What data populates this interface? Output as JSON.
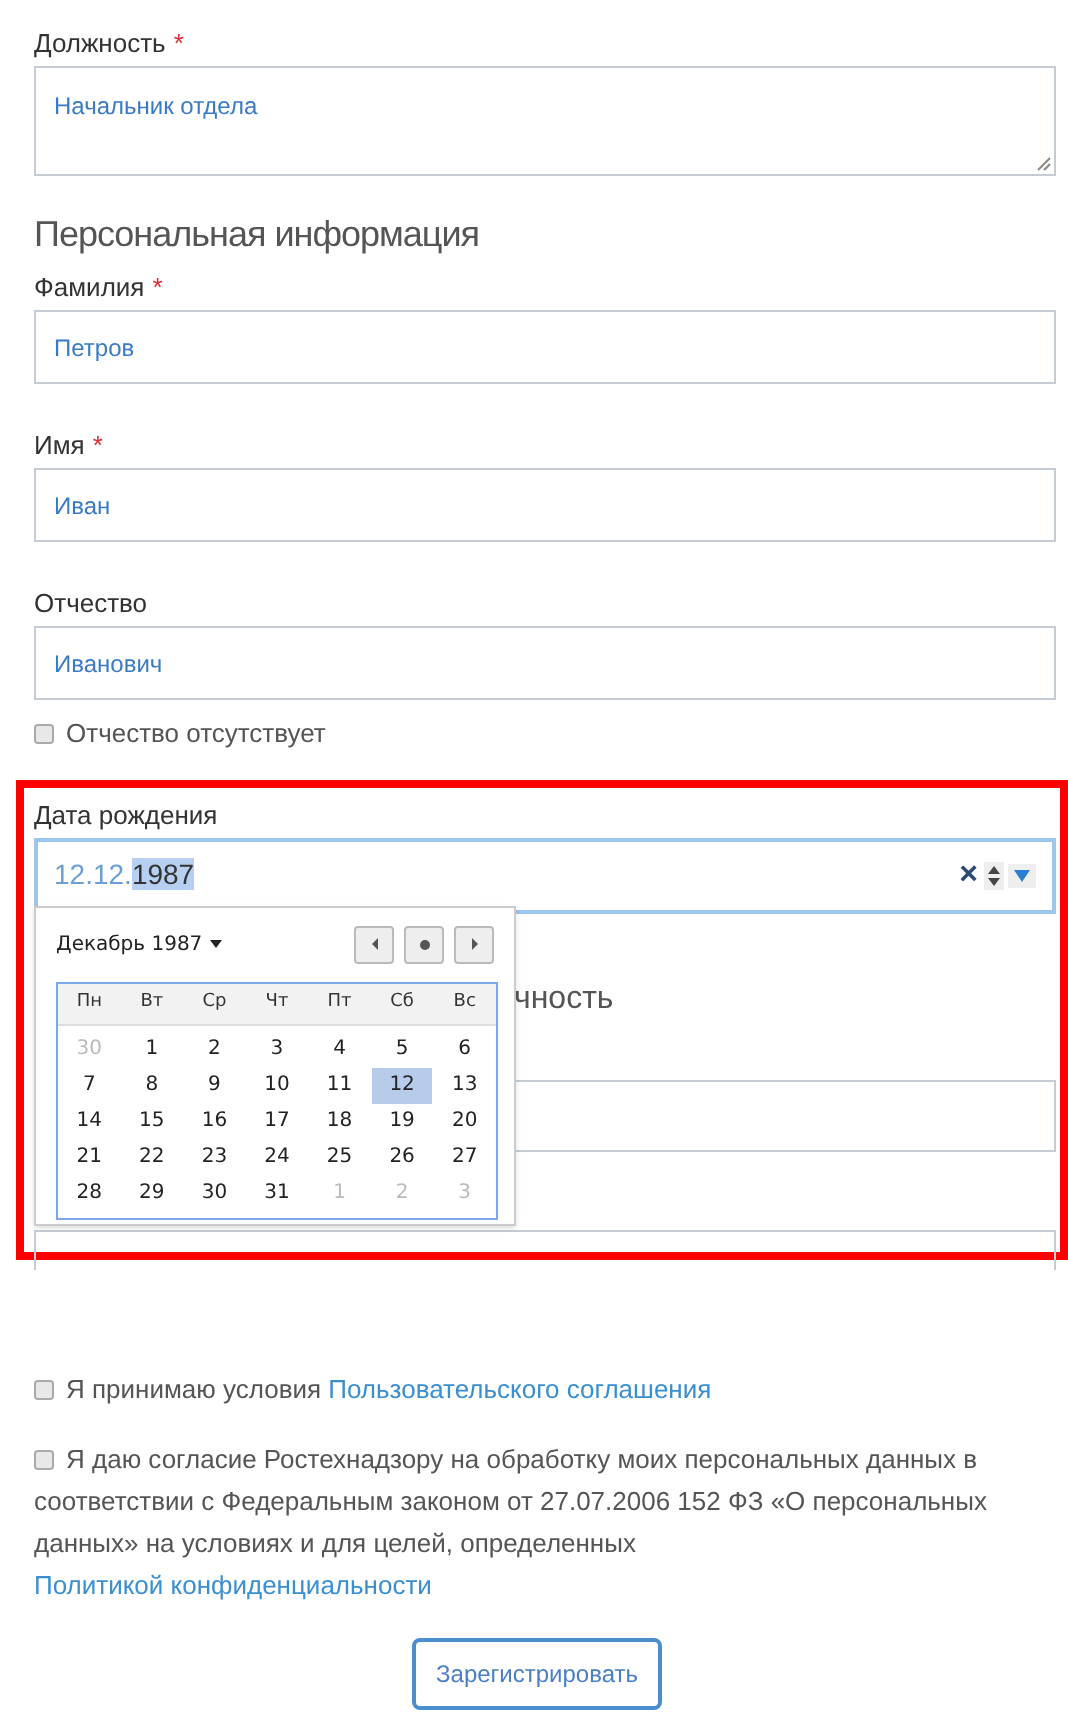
{
  "position_field": {
    "label": "Должность",
    "required_mark": "*",
    "value": "Начальник отдела"
  },
  "section_heading": "Персональная информация",
  "fields": [
    {
      "label": "Фамилия",
      "required_mark": "*",
      "value": "Петров"
    },
    {
      "label": "Имя",
      "required_mark": "*",
      "value": "Иван"
    },
    {
      "label": "Отчество",
      "value": "Иванович"
    }
  ],
  "no_patronymic": {
    "label": "Отчество отсутствует",
    "checked": false
  },
  "birth_date": {
    "label": "Дата рождения",
    "value": "12.12.",
    "value_selected": "1987",
    "clear": "×"
  },
  "hidden_heading": "чность",
  "calendar": {
    "month": "Декабрь 1987",
    "weekdays": [
      "Пн",
      "Вт",
      "Ср",
      "Чт",
      "Пт",
      "Сб",
      "Вс"
    ],
    "weeks": [
      [
        {
          "day": "30",
          "outside": true,
          "selected": false
        },
        {
          "day": "1",
          "outside": false,
          "selected": false
        },
        {
          "day": "2",
          "outside": false,
          "selected": false
        },
        {
          "day": "3",
          "outside": false,
          "selected": false
        },
        {
          "day": "4",
          "outside": false,
          "selected": false
        },
        {
          "day": "5",
          "outside": false,
          "selected": false
        },
        {
          "day": "6",
          "outside": false,
          "selected": false
        }
      ],
      [
        {
          "day": "7",
          "outside": false,
          "selected": false
        },
        {
          "day": "8",
          "outside": false,
          "selected": false
        },
        {
          "day": "9",
          "outside": false,
          "selected": false
        },
        {
          "day": "10",
          "outside": false,
          "selected": false
        },
        {
          "day": "11",
          "outside": false,
          "selected": false
        },
        {
          "day": "12",
          "outside": false,
          "selected": true
        },
        {
          "day": "13",
          "outside": false,
          "selected": false
        }
      ],
      [
        {
          "day": "14",
          "outside": false,
          "selected": false
        },
        {
          "day": "15",
          "outside": false,
          "selected": false
        },
        {
          "day": "16",
          "outside": false,
          "selected": false
        },
        {
          "day": "17",
          "outside": false,
          "selected": false
        },
        {
          "day": "18",
          "outside": false,
          "selected": false
        },
        {
          "day": "19",
          "outside": false,
          "selected": false
        },
        {
          "day": "20",
          "outside": false,
          "selected": false
        }
      ],
      [
        {
          "day": "21",
          "outside": false,
          "selected": false
        },
        {
          "day": "22",
          "outside": false,
          "selected": false
        },
        {
          "day": "23",
          "outside": false,
          "selected": false
        },
        {
          "day": "24",
          "outside": false,
          "selected": false
        },
        {
          "day": "25",
          "outside": false,
          "selected": false
        },
        {
          "day": "26",
          "outside": false,
          "selected": false
        },
        {
          "day": "27",
          "outside": false,
          "selected": false
        }
      ],
      [
        {
          "day": "28",
          "outside": false,
          "selected": false
        },
        {
          "day": "29",
          "outside": false,
          "selected": false
        },
        {
          "day": "30",
          "outside": false,
          "selected": false
        },
        {
          "day": "31",
          "outside": false,
          "selected": false
        },
        {
          "day": "1",
          "outside": true,
          "selected": false
        },
        {
          "day": "2",
          "outside": true,
          "selected": false
        },
        {
          "day": "3",
          "outside": true,
          "selected": false
        }
      ]
    ]
  },
  "agreements": [
    {
      "text": "Я принимаю условия ",
      "link": "Пользовательского соглашения",
      "checked": false
    },
    {
      "text": "Я даю согласие Ростехнадзору на обработку моих персональных данных в соответствии с Федеральным законом от 27.07.2006 152 ФЗ «О персональных данных» на условиях и для целей, определенных ",
      "link": "Политикой конфиденциальности",
      "checked": false
    }
  ],
  "submit": "Зарегистрировать"
}
